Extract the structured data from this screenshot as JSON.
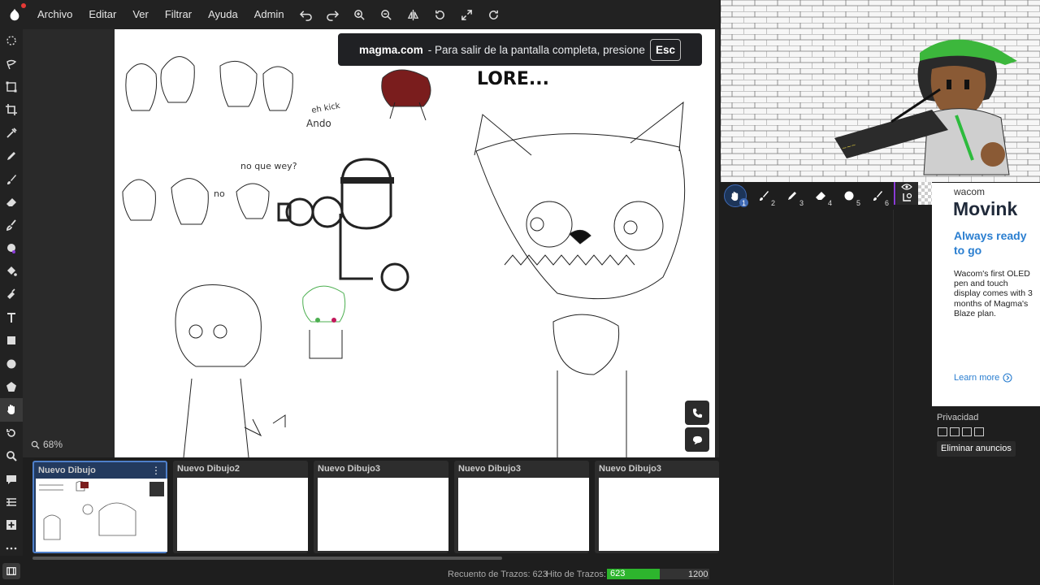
{
  "menu": {
    "items": [
      "Archivo",
      "Editar",
      "Ver",
      "Filtrar",
      "Ayuda",
      "Admin"
    ]
  },
  "toolbar_icons": [
    "undo-icon",
    "redo-icon",
    "zoom-in-icon",
    "zoom-out-icon",
    "flip-icon",
    "rotate-icon",
    "fullscreen-icon",
    "reset-rotation-icon"
  ],
  "left_tools": [
    "lasso-select-icon",
    "lasso-move-icon",
    "transform-icon",
    "crop-icon",
    "eyedropper-icon",
    "pencil-icon",
    "brush-icon",
    "eraser-icon",
    "smudge-icon",
    "blend-icon",
    "fill-icon",
    "blur-icon",
    "text-icon",
    "rectangle-icon",
    "ellipse-icon",
    "polygon-icon",
    "hand-icon",
    "undo-icon",
    "zoom-icon",
    "chat-icon",
    "layers-icon",
    "add-icon",
    "more-icon"
  ],
  "canvas": {
    "zoom": "68%",
    "fullscreen_notice": {
      "domain": "magma.com",
      "message": "-  Para salir de la pantalla completa, presione",
      "key": "Esc"
    },
    "handwriting": {
      "note1": "eh kick",
      "note2": "Ando",
      "note3": "no que wey?",
      "note4": "no",
      "note5": "LORE..."
    }
  },
  "thumbnails": [
    {
      "title": "Nuevo Dibujo",
      "active": true
    },
    {
      "title": "Nuevo Dibujo2",
      "active": false
    },
    {
      "title": "Nuevo Dibujo3",
      "active": false
    },
    {
      "title": "Nuevo Dibujo3",
      "active": false
    },
    {
      "title": "Nuevo Dibujo3",
      "active": false
    }
  ],
  "status": {
    "stroke_count_label": "Recuento de Trazos: 623",
    "milestone_label": "Hito de Trazos:",
    "progress_value": "623",
    "progress_max": "1200",
    "progress_fraction": 0.519,
    "progress_color": "#2db52d"
  },
  "brushes": [
    {
      "icon": "hand-icon",
      "num": "1"
    },
    {
      "icon": "brush-icon",
      "num": "2"
    },
    {
      "icon": "pen-icon",
      "num": "3"
    },
    {
      "icon": "eraser-icon",
      "num": "4"
    },
    {
      "icon": "circle-brush-icon",
      "num": "5"
    },
    {
      "icon": "brush-icon",
      "num": "6"
    }
  ],
  "ad": {
    "brand": "wacom",
    "product": "Movink",
    "tagline": "Always ready to go",
    "body": "Wacom's first OLED pen and touch display comes with 3 months of Magma's Blaze plan.",
    "learn_more": "Learn more"
  },
  "privacy": {
    "label": "Privacidad",
    "remove_ads": "Eliminar anuncios"
  },
  "colors": {
    "accent": "#4e7fc9",
    "layer_indicator": "#8a3bd6"
  }
}
